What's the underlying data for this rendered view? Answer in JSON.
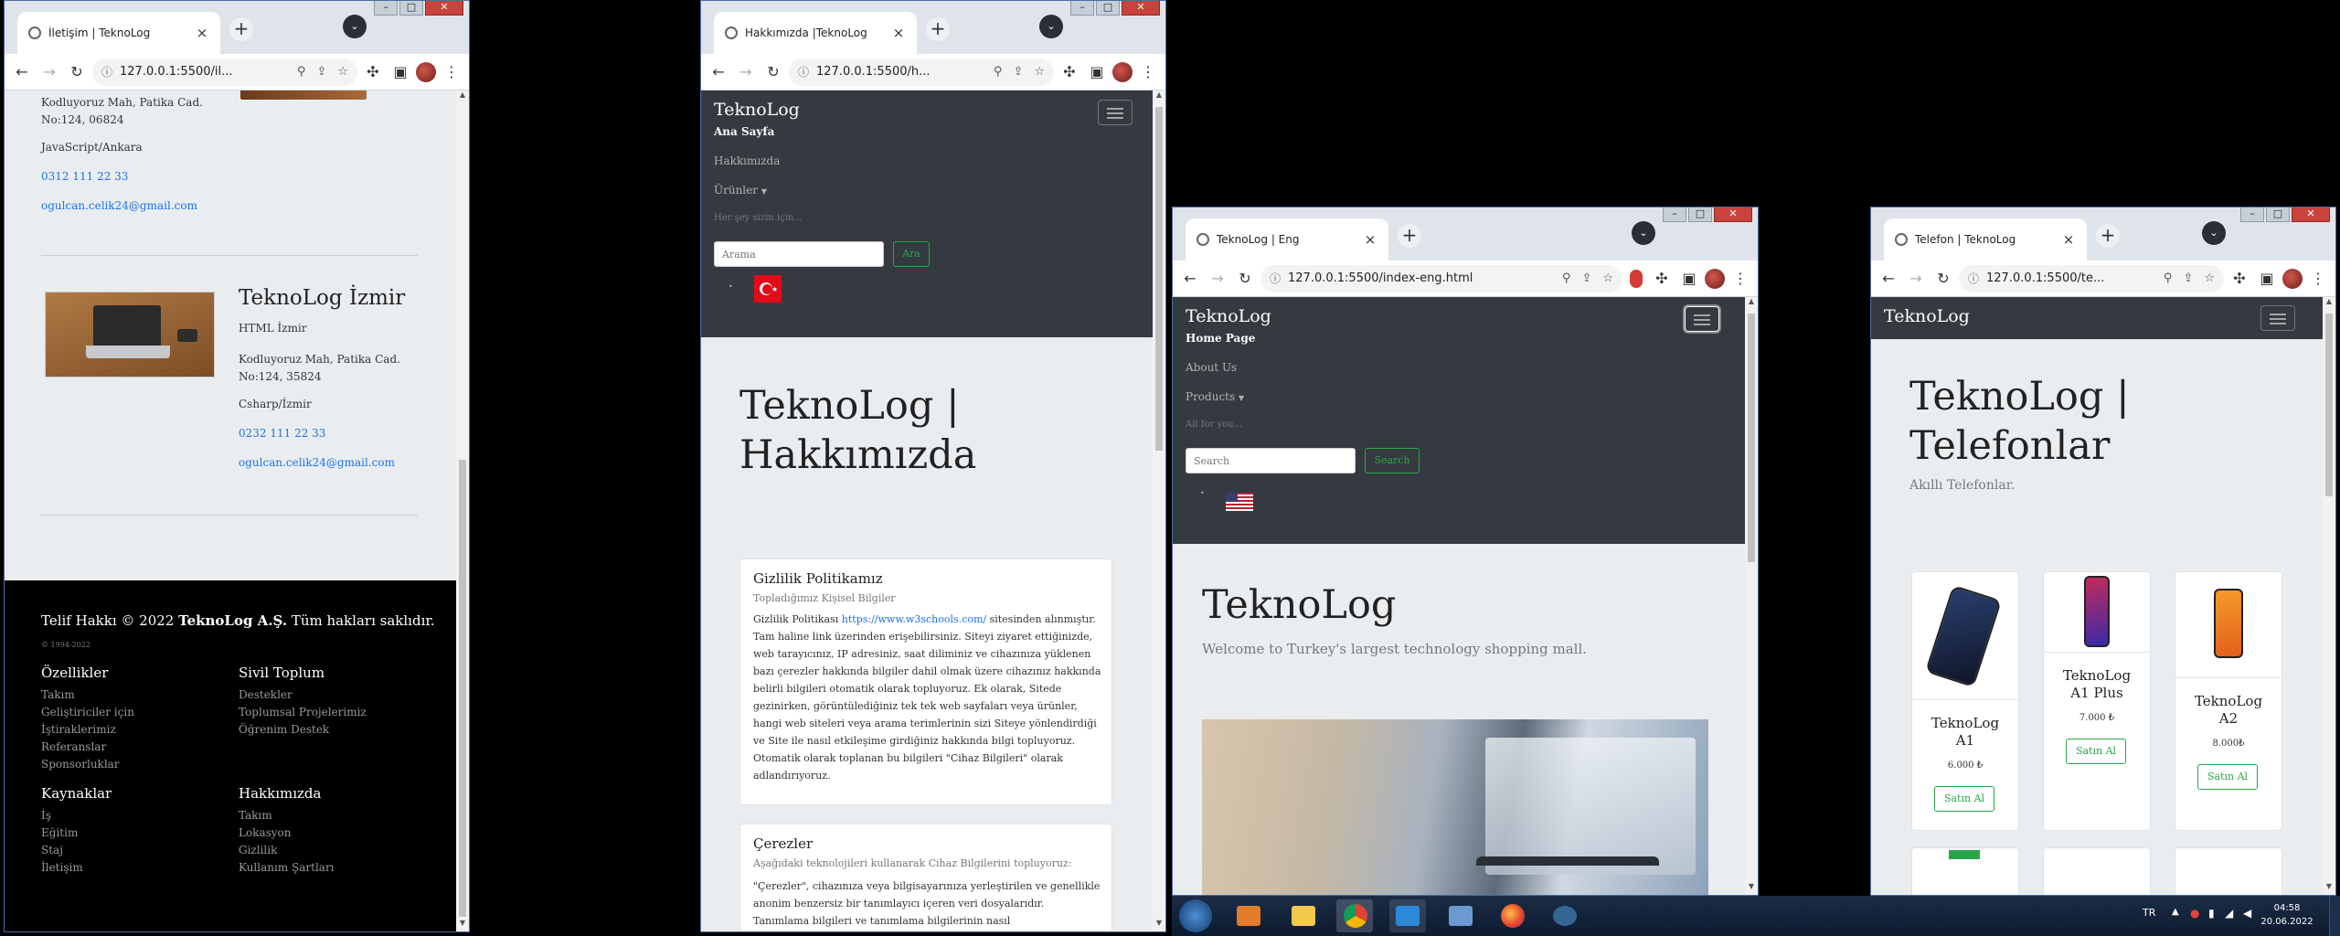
{
  "win1": {
    "tab_title": "İletişim | TeknoLog",
    "url": "127.0.0.1:5500/il...",
    "contact_top": {
      "address_line1": "Kodluyoruz Mah, Patika Cad.",
      "address_line2": "No:124, 06824",
      "dept": "JavaScript/Ankara",
      "phone": "0312 111 22 33",
      "email": "ogulcan.celik24@gmail.com"
    },
    "izmir": {
      "title": "TeknoLog İzmir",
      "dept1": "HTML İzmir",
      "address_line1": "Kodluyoruz Mah, Patika Cad.",
      "address_line2": "No:124, 35824",
      "dept2": "Csharp/İzmir",
      "phone": "0232 111 22 33",
      "email": "ogulcan.celik24@gmail.com"
    },
    "footer": {
      "copyright_prefix": "Telif Hakkı © 2022 ",
      "copyright_company": "TeknoLog A.Ş.",
      "copyright_suffix": " Tüm hakları saklıdır.",
      "years": "© 1994-2022",
      "col1": {
        "title": "Özellikler",
        "items": [
          "Takım",
          "Geliştiriciler için",
          "İştiraklerimiz",
          "Referanslar",
          "Sponsorluklar"
        ]
      },
      "col2": {
        "title": "Sivil Toplum",
        "items": [
          "Destekler",
          "Toplumsal Projelerimiz",
          "Öğrenim Destek"
        ]
      },
      "col3": {
        "title": "Kaynaklar",
        "items": [
          "İş",
          "Eğitim",
          "Staj",
          "İletişim"
        ]
      },
      "col4": {
        "title": "Hakkımızda",
        "items": [
          "Takım",
          "Lokasyon",
          "Gizlilik",
          "Kullanım Şartları"
        ]
      }
    }
  },
  "win2": {
    "tab_title": "Hakkımızda |TeknoLog",
    "url": "127.0.0.1:5500/h...",
    "brand": "TeknoLog",
    "nav": [
      "Ana Sayfa",
      "Hakkımızda",
      "Ürünler"
    ],
    "tagline": "Her şey sizin için...",
    "search_placeholder": "Arama",
    "search_button": "Ara",
    "hero_title": "TeknoLog |",
    "hero_title2": "Hakkımızda",
    "card1": {
      "title": "Gizlilik Politikamız",
      "subtitle": "Topladığımız Kişisel Bilgiler",
      "body_prefix": "Gizlilik Politikası ",
      "body_link": "https://www.w3schools.com/",
      "body_suffix": " sitesinden alınmıştır. Tam haline link üzerinden erişebilirsiniz. Siteyi ziyaret ettiğinizde, web tarayıcınız, IP adresiniz, saat diliminiz ve cihazınıza yüklenen bazı çerezler hakkında bilgiler dahil olmak üzere cihazınız hakkında belirli bilgileri otomatik olarak topluyoruz. Ek olarak, Sitede gezinirken, görüntülediğiniz tek tek web sayfaları veya ürünler, hangi web siteleri veya arama terimlerinin sizi Siteye yönlendirdiği ve Site ile nasıl etkileşime girdiğiniz hakkında bilgi topluyoruz. Otomatik olarak toplanan bu bilgileri \"Cihaz Bilgileri\" olarak adlandırıyoruz."
    },
    "card2": {
      "title": "Çerezler",
      "subtitle": "Aşağıdaki teknolojileri kullanarak Cihaz Bilgilerini topluyoruz:",
      "body": "\"Çerezler\", cihazınıza veya bilgisayarınıza yerleştirilen ve genellikle anonim benzersiz bir tanımlayıcı içeren veri dosyalarıdır. Tanımlama bilgileri ve tanımlama bilgilerinin nasıl"
    }
  },
  "win3": {
    "tab_title": "TeknoLog | Eng",
    "url": "127.0.0.1:5500/index-eng.html",
    "brand": "TeknoLog",
    "nav": [
      "Home Page",
      "About Us",
      "Products"
    ],
    "tagline": "All for you...",
    "search_placeholder": "Search",
    "search_button": "Search",
    "hero_title": "TeknoLog",
    "hero_sub": "Welcome to Turkey's largest technology shopping mall."
  },
  "win4": {
    "tab_title": "Telefon | TeknoLog",
    "url": "127.0.0.1:5500/te...",
    "brand": "TeknoLog",
    "hero_title": "TeknoLog |",
    "hero_title2": "Telefonlar",
    "hero_sub": "Akıllı Telefonlar.",
    "products": [
      {
        "name1": "TeknoLog",
        "name2": "A1",
        "price": "6.000 ₺",
        "button": "Satın Al"
      },
      {
        "name1": "TeknoLog",
        "name2": "A1 Plus",
        "price": "7.000 ₺",
        "button": "Satın Al"
      },
      {
        "name1": "TeknoLog",
        "name2": "A2",
        "price": "8.000₺",
        "button": "Satın Al"
      }
    ]
  },
  "taskbar": {
    "lang": "TR",
    "time": "04:58",
    "date": "20.06.2022"
  },
  "colors": {
    "navbar": "#343a40",
    "accent_green": "#28a745",
    "link": "#1a73e8",
    "footer": "#000000"
  }
}
